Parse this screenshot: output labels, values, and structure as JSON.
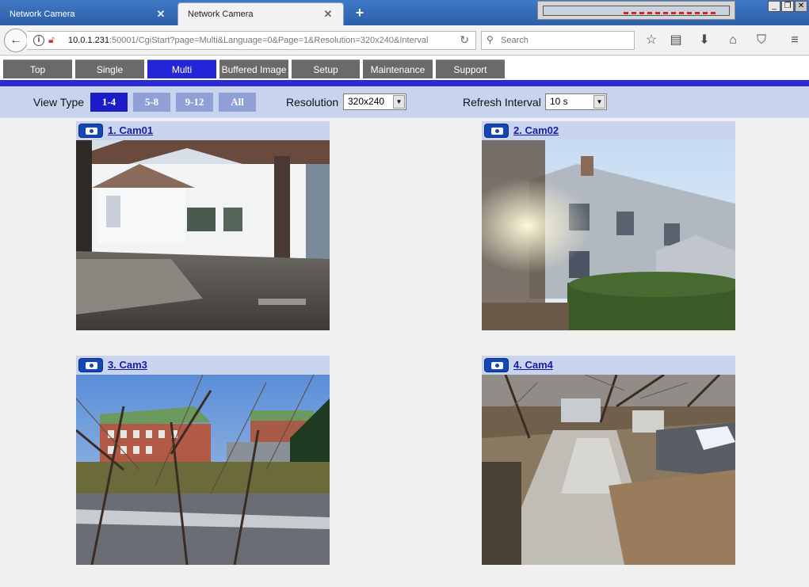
{
  "browser": {
    "tabs": [
      {
        "title": "Network Camera",
        "active": false
      },
      {
        "title": "Network Camera",
        "active": true
      }
    ],
    "new_tab_label": "+",
    "url_host": "10.0.1.231",
    "url_rest": ":50001/CgiStart?page=Multi&Language=0&Page=1&Resolution=320x240&Interval",
    "search_placeholder": "Search"
  },
  "icons": {
    "back": "back-arrow-icon",
    "info": "info-icon",
    "insecure": "insecure-lock-icon",
    "reload": "reload-icon",
    "search": "search-icon",
    "bookmark": "star-icon",
    "library": "library-icon",
    "download": "download-icon",
    "home": "home-icon",
    "pocket": "pocket-icon",
    "menu": "hamburger-menu-icon",
    "camera": "camera-icon"
  },
  "menu": {
    "tabs": [
      "Top",
      "Single",
      "Multi",
      "Buffered Image",
      "Setup",
      "Maintenance",
      "Support"
    ],
    "active_tab": "Multi"
  },
  "toolbar": {
    "view_type_label": "View Type",
    "view_types": [
      "1-4",
      "5-8",
      "9-12",
      "All"
    ],
    "active_view_type": "1-4",
    "resolution_label": "Resolution",
    "resolution_value": "320x240",
    "refresh_label": "Refresh Interval",
    "refresh_value": "10 s"
  },
  "cameras": [
    {
      "label": "1. Cam01"
    },
    {
      "label": "2. Cam02"
    },
    {
      "label": "3. Cam3"
    },
    {
      "label": "4. Cam4"
    }
  ],
  "colors": {
    "menu_active": "#2424d8",
    "menu_inactive": "#6a6a6a",
    "toolbar_bg": "#c8d4ee",
    "view_active": "#1c1cc8",
    "view_inactive": "#8ea0d6",
    "link": "#1a1aa8"
  }
}
